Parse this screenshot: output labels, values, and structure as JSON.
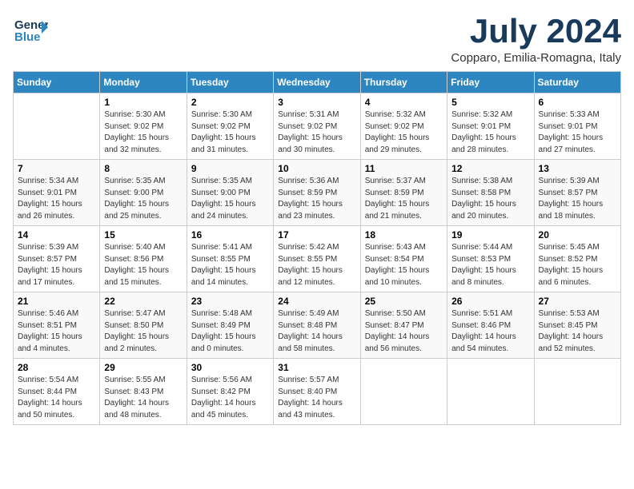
{
  "header": {
    "logo_line1": "General",
    "logo_line2": "Blue",
    "month": "July 2024",
    "location": "Copparo, Emilia-Romagna, Italy"
  },
  "days_of_week": [
    "Sunday",
    "Monday",
    "Tuesday",
    "Wednesday",
    "Thursday",
    "Friday",
    "Saturday"
  ],
  "weeks": [
    [
      {
        "num": "",
        "info": ""
      },
      {
        "num": "1",
        "info": "Sunrise: 5:30 AM\nSunset: 9:02 PM\nDaylight: 15 hours\nand 32 minutes."
      },
      {
        "num": "2",
        "info": "Sunrise: 5:30 AM\nSunset: 9:02 PM\nDaylight: 15 hours\nand 31 minutes."
      },
      {
        "num": "3",
        "info": "Sunrise: 5:31 AM\nSunset: 9:02 PM\nDaylight: 15 hours\nand 30 minutes."
      },
      {
        "num": "4",
        "info": "Sunrise: 5:32 AM\nSunset: 9:02 PM\nDaylight: 15 hours\nand 29 minutes."
      },
      {
        "num": "5",
        "info": "Sunrise: 5:32 AM\nSunset: 9:01 PM\nDaylight: 15 hours\nand 28 minutes."
      },
      {
        "num": "6",
        "info": "Sunrise: 5:33 AM\nSunset: 9:01 PM\nDaylight: 15 hours\nand 27 minutes."
      }
    ],
    [
      {
        "num": "7",
        "info": "Sunrise: 5:34 AM\nSunset: 9:01 PM\nDaylight: 15 hours\nand 26 minutes."
      },
      {
        "num": "8",
        "info": "Sunrise: 5:35 AM\nSunset: 9:00 PM\nDaylight: 15 hours\nand 25 minutes."
      },
      {
        "num": "9",
        "info": "Sunrise: 5:35 AM\nSunset: 9:00 PM\nDaylight: 15 hours\nand 24 minutes."
      },
      {
        "num": "10",
        "info": "Sunrise: 5:36 AM\nSunset: 8:59 PM\nDaylight: 15 hours\nand 23 minutes."
      },
      {
        "num": "11",
        "info": "Sunrise: 5:37 AM\nSunset: 8:59 PM\nDaylight: 15 hours\nand 21 minutes."
      },
      {
        "num": "12",
        "info": "Sunrise: 5:38 AM\nSunset: 8:58 PM\nDaylight: 15 hours\nand 20 minutes."
      },
      {
        "num": "13",
        "info": "Sunrise: 5:39 AM\nSunset: 8:57 PM\nDaylight: 15 hours\nand 18 minutes."
      }
    ],
    [
      {
        "num": "14",
        "info": "Sunrise: 5:39 AM\nSunset: 8:57 PM\nDaylight: 15 hours\nand 17 minutes."
      },
      {
        "num": "15",
        "info": "Sunrise: 5:40 AM\nSunset: 8:56 PM\nDaylight: 15 hours\nand 15 minutes."
      },
      {
        "num": "16",
        "info": "Sunrise: 5:41 AM\nSunset: 8:55 PM\nDaylight: 15 hours\nand 14 minutes."
      },
      {
        "num": "17",
        "info": "Sunrise: 5:42 AM\nSunset: 8:55 PM\nDaylight: 15 hours\nand 12 minutes."
      },
      {
        "num": "18",
        "info": "Sunrise: 5:43 AM\nSunset: 8:54 PM\nDaylight: 15 hours\nand 10 minutes."
      },
      {
        "num": "19",
        "info": "Sunrise: 5:44 AM\nSunset: 8:53 PM\nDaylight: 15 hours\nand 8 minutes."
      },
      {
        "num": "20",
        "info": "Sunrise: 5:45 AM\nSunset: 8:52 PM\nDaylight: 15 hours\nand 6 minutes."
      }
    ],
    [
      {
        "num": "21",
        "info": "Sunrise: 5:46 AM\nSunset: 8:51 PM\nDaylight: 15 hours\nand 4 minutes."
      },
      {
        "num": "22",
        "info": "Sunrise: 5:47 AM\nSunset: 8:50 PM\nDaylight: 15 hours\nand 2 minutes."
      },
      {
        "num": "23",
        "info": "Sunrise: 5:48 AM\nSunset: 8:49 PM\nDaylight: 15 hours\nand 0 minutes."
      },
      {
        "num": "24",
        "info": "Sunrise: 5:49 AM\nSunset: 8:48 PM\nDaylight: 14 hours\nand 58 minutes."
      },
      {
        "num": "25",
        "info": "Sunrise: 5:50 AM\nSunset: 8:47 PM\nDaylight: 14 hours\nand 56 minutes."
      },
      {
        "num": "26",
        "info": "Sunrise: 5:51 AM\nSunset: 8:46 PM\nDaylight: 14 hours\nand 54 minutes."
      },
      {
        "num": "27",
        "info": "Sunrise: 5:53 AM\nSunset: 8:45 PM\nDaylight: 14 hours\nand 52 minutes."
      }
    ],
    [
      {
        "num": "28",
        "info": "Sunrise: 5:54 AM\nSunset: 8:44 PM\nDaylight: 14 hours\nand 50 minutes."
      },
      {
        "num": "29",
        "info": "Sunrise: 5:55 AM\nSunset: 8:43 PM\nDaylight: 14 hours\nand 48 minutes."
      },
      {
        "num": "30",
        "info": "Sunrise: 5:56 AM\nSunset: 8:42 PM\nDaylight: 14 hours\nand 45 minutes."
      },
      {
        "num": "31",
        "info": "Sunrise: 5:57 AM\nSunset: 8:40 PM\nDaylight: 14 hours\nand 43 minutes."
      },
      {
        "num": "",
        "info": ""
      },
      {
        "num": "",
        "info": ""
      },
      {
        "num": "",
        "info": ""
      }
    ]
  ]
}
